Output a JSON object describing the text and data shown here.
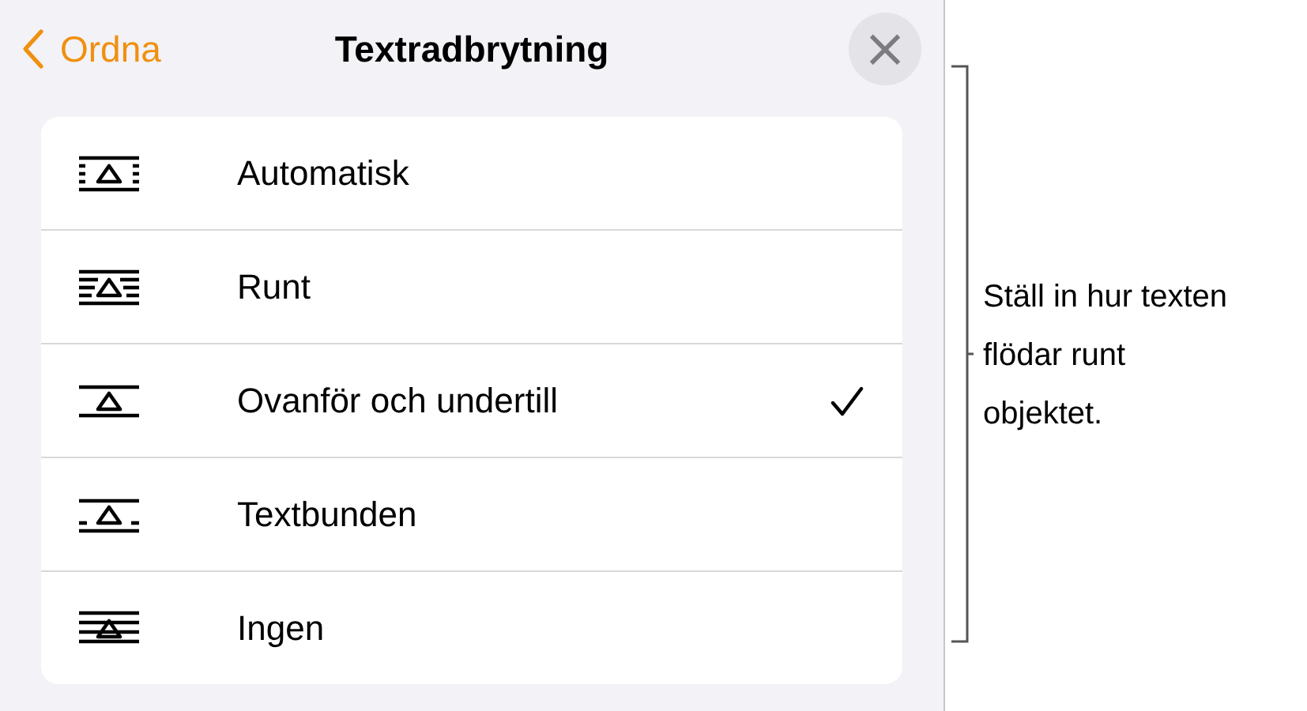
{
  "header": {
    "back": "Ordna",
    "title": "Textradbrytning",
    "close": "×"
  },
  "options": [
    {
      "kind": "auto",
      "label": "Automatisk",
      "selected": false
    },
    {
      "kind": "around",
      "label": "Runt",
      "selected": false
    },
    {
      "kind": "above-below",
      "label": "Ovanför och undertill",
      "selected": true
    },
    {
      "kind": "inline",
      "label": "Textbunden",
      "selected": false
    },
    {
      "kind": "none",
      "label": "Ingen",
      "selected": false
    }
  ],
  "callout": "Ställ in hur texten flödar runt objektet."
}
